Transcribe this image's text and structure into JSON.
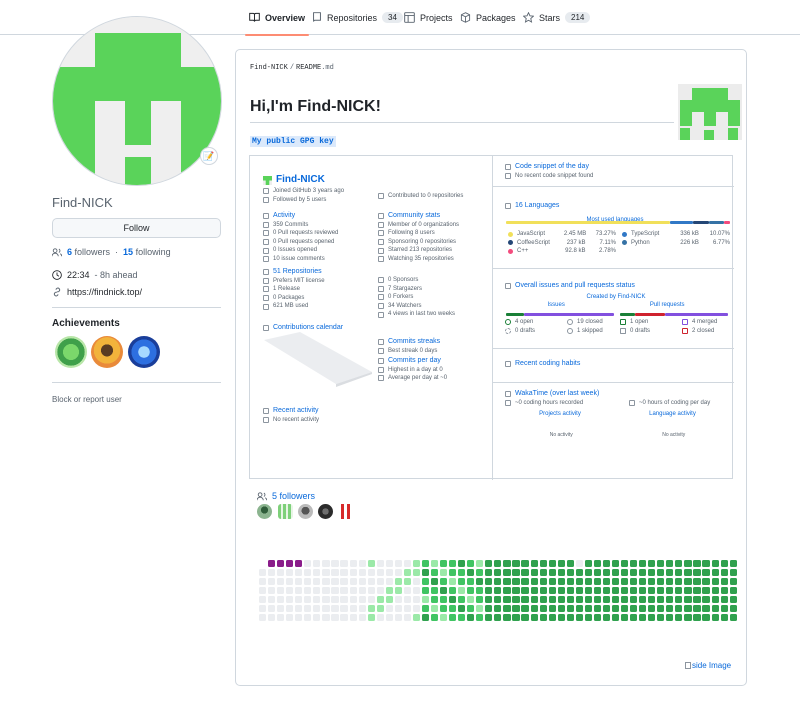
{
  "tabs": [
    {
      "label": "Overview",
      "icon": "book-icon",
      "count": null
    },
    {
      "label": "Repositories",
      "icon": "repo-icon",
      "count": "34"
    },
    {
      "label": "Projects",
      "icon": "table-icon",
      "count": null
    },
    {
      "label": "Packages",
      "icon": "package-icon",
      "count": null
    },
    {
      "label": "Stars",
      "icon": "star-icon",
      "count": "214"
    }
  ],
  "profile": {
    "username": "Find-NICK",
    "follow_label": "Follow",
    "followers_count": "6",
    "followers_label": "followers",
    "following_count": "15",
    "following_label": "following",
    "separator": "·",
    "time": "22:34",
    "time_note": "- 8h ahead",
    "website": "https://findnick.top/",
    "achievements_title": "Achievements",
    "block_label": "Block or report user"
  },
  "readme": {
    "path_user": "Find-NICK",
    "path_sep": "/",
    "path_file": "README",
    "path_ext": ".md",
    "heading": "Hi,I'm Find-NICK!",
    "gpg_link": "My public GPG key"
  },
  "stats": {
    "name": "Find-NICK",
    "joined": "Joined GitHub 3 years ago",
    "followed": "Followed by 5 users",
    "contributed": "Contributed to 0 repositories",
    "activity_title": "Activity",
    "activity": [
      "359 Commits",
      "0 Pull requests reviewed",
      "0 Pull requests opened",
      "0 Issues opened",
      "10 issue comments"
    ],
    "community_title": "Community stats",
    "community": [
      "Member of 0 organizations",
      "Following 8 users",
      "Sponsoring 0 repositories",
      "Starred 213 repositories",
      "Watching 35 repositories"
    ],
    "repos_title": "51 Repositories",
    "repos": [
      "Prefers MIT license",
      "1 Release",
      "0 Packages",
      "621 MB used"
    ],
    "repos2": [
      "0 Sponsors",
      "7 Stargazers",
      "0 Forkers",
      "34 Watchers",
      "4 views in last two weeks"
    ],
    "calendar_title": "Contributions calendar",
    "streaks_title": "Commits streaks",
    "streaks": [
      "Best streak 0 days"
    ],
    "perday_title": "Commits per day",
    "perday": [
      "Highest in a day at 0",
      "Average per day at ~0"
    ],
    "recent_title": "Recent activity",
    "recent": "No recent activity",
    "snippet_title": "Code snippet of the day",
    "snippet": "No recent code snippet found",
    "langs_title": "16 Languages",
    "langs_sub": "Most used languages",
    "languages": [
      {
        "name": "JavaScript",
        "size": "2.45 MB",
        "pct": "73.27%",
        "color": "#f1e05a"
      },
      {
        "name": "CoffeeScript",
        "size": "237 kB",
        "pct": "7.11%",
        "color": "#244776"
      },
      {
        "name": "C++",
        "size": "92.8 kB",
        "pct": "2.78%",
        "color": "#f34b7d"
      },
      {
        "name": "TypeScript",
        "size": "336 kB",
        "pct": "10.07%",
        "color": "#3178c6"
      },
      {
        "name": "Python",
        "size": "226 kB",
        "pct": "6.77%",
        "color": "#3572A5"
      }
    ],
    "issues_title": "Overall issues and pull requests status",
    "issues_sub": "Created by Find-NICK",
    "issues_label": "Issues",
    "prs_label": "Pull requests",
    "issues": [
      "4 open",
      "19 closed",
      "0 drafts",
      "1 skipped"
    ],
    "prs": [
      "1 open",
      "4 merged",
      "0 drafts",
      "2 closed"
    ],
    "habits_title": "Recent coding habits",
    "wakatime_title": "WakaTime (over last week)",
    "wakatime_a": "~0 coding hours recorded",
    "wakatime_b": "~0 hours of coding per day",
    "projects_activity": "Projects activity",
    "language_activity": "Language activity",
    "no_activity": "No activity"
  },
  "followers": {
    "title": "5 followers",
    "count": 5
  },
  "side_image_alt": "side Image",
  "colors": {
    "avatar_green": "#5ad35a",
    "accent": "#0969da",
    "tab_underline": "#fd8c73"
  }
}
